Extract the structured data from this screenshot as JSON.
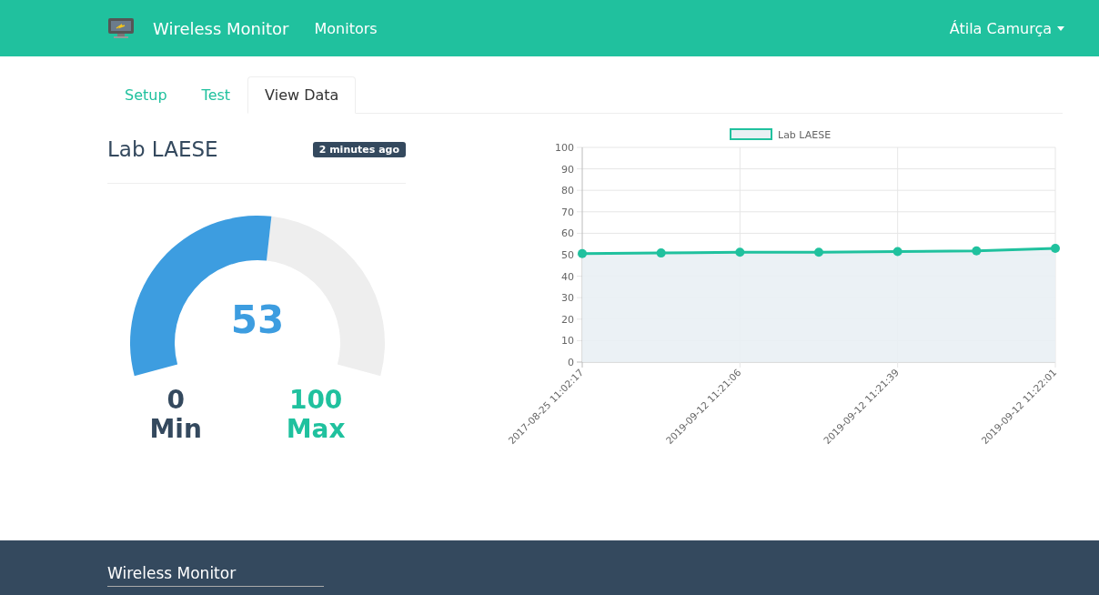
{
  "navbar": {
    "brand": "Wireless Monitor",
    "links": [
      "Monitors"
    ],
    "user": "Átila Camurça"
  },
  "tabs": [
    {
      "label": "Setup",
      "selected": false
    },
    {
      "label": "Test",
      "selected": false
    },
    {
      "label": "View Data",
      "selected": true
    }
  ],
  "monitor": {
    "title": "Lab LAESE",
    "updated": "2 minutes ago",
    "value": "53",
    "level": 0.53,
    "min": {
      "value": "0",
      "label": "Min"
    },
    "max": {
      "value": "100",
      "label": "Max"
    }
  },
  "chart_data": {
    "type": "area",
    "categories": [
      "2017-08-25 11:02:17",
      null,
      "2019-09-12 11:21:06",
      null,
      "2019-09-12 11:21:39",
      null,
      "2019-09-12 11:22:01"
    ],
    "series": [
      {
        "name": "Lab LAESE",
        "color": "#20c19e",
        "values": [
          50.5,
          50.8,
          51.2,
          51.2,
          51.5,
          51.8,
          53
        ]
      }
    ],
    "ylim": [
      0,
      100
    ],
    "grid": true,
    "yticks": [
      0,
      10,
      20,
      30,
      40,
      50,
      60,
      70,
      80,
      90,
      100
    ]
  },
  "footer": {
    "title": "Wireless Monitor"
  }
}
